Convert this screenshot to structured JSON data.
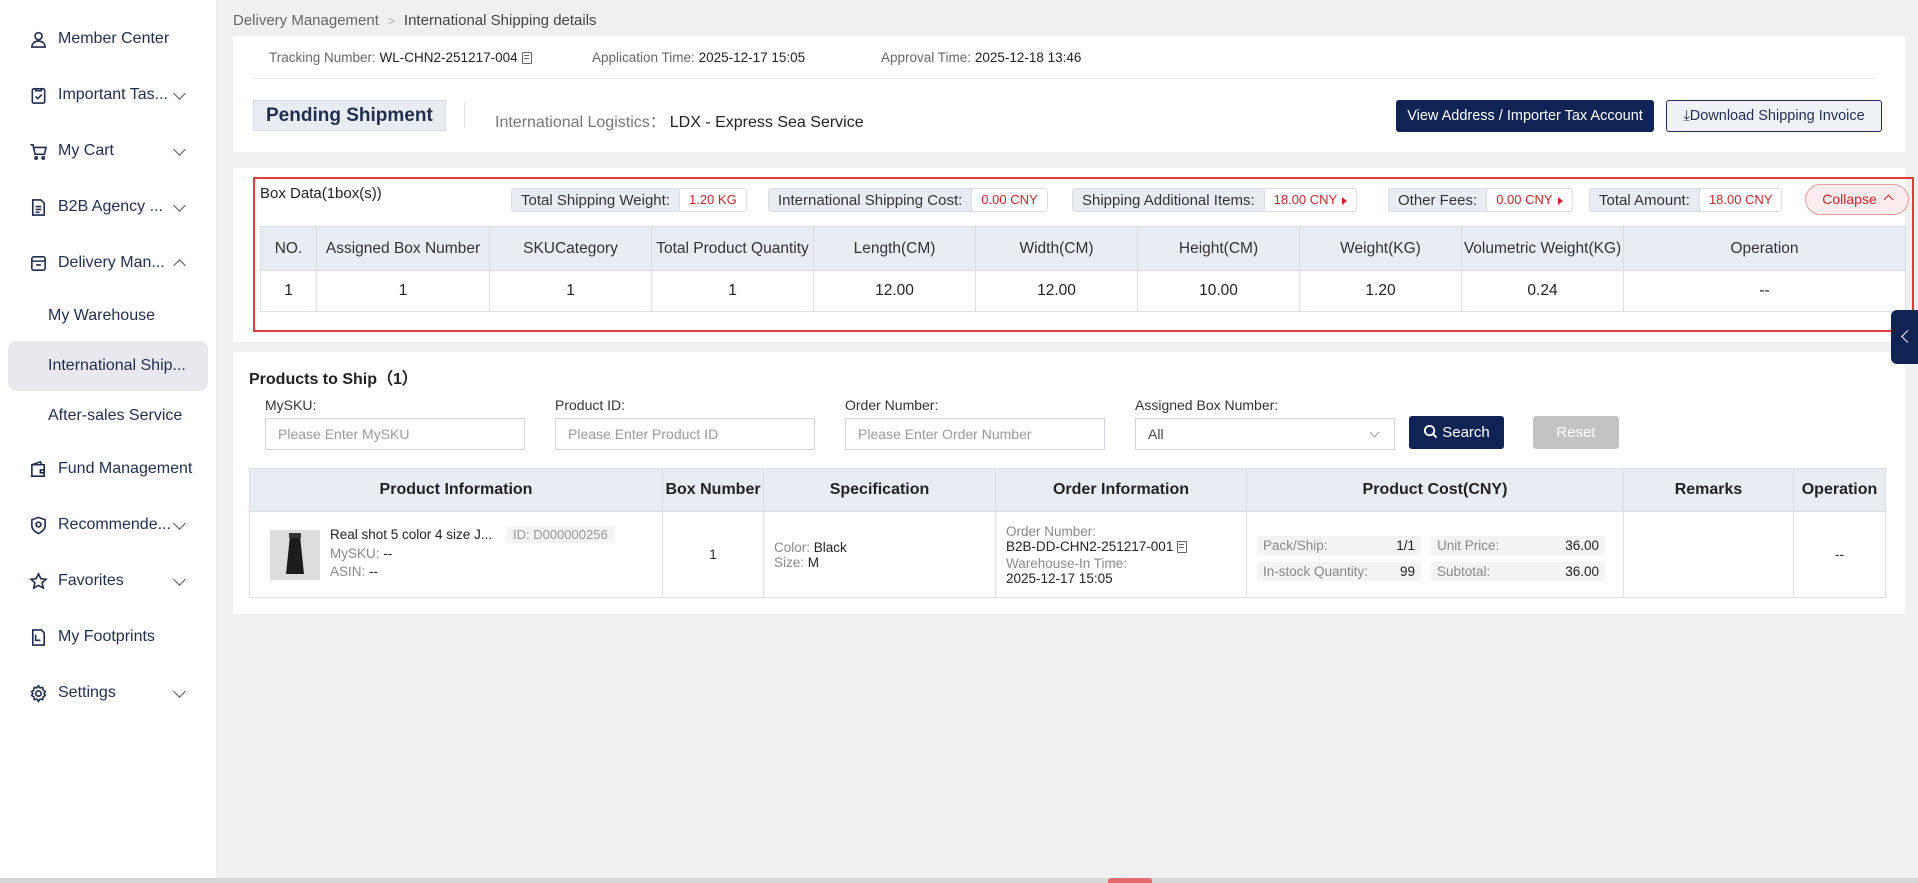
{
  "sidebar": {
    "items": [
      {
        "label": "Member Center",
        "icon": "user-icon"
      },
      {
        "label": "Important Tas...",
        "icon": "clipboard-check-icon"
      },
      {
        "label": "My Cart",
        "icon": "cart-icon"
      },
      {
        "label": "B2B Agency ...",
        "icon": "document-icon"
      },
      {
        "label": "Delivery Man...",
        "icon": "delivery-icon"
      },
      {
        "label": "My Warehouse"
      },
      {
        "label": "International Ship..."
      },
      {
        "label": "After-sales Service"
      },
      {
        "label": "Fund Management",
        "icon": "wallet-icon"
      },
      {
        "label": "Recommende...",
        "icon": "badge-icon"
      },
      {
        "label": "Favorites",
        "icon": "star-icon"
      },
      {
        "label": "My Footprints",
        "icon": "footprint-icon"
      },
      {
        "label": "Settings",
        "icon": "gear-icon"
      }
    ]
  },
  "breadcrumb": {
    "parent": "Delivery Management",
    "current": "International Shipping details"
  },
  "header": {
    "tracking_label": "Tracking Number:",
    "tracking_value": "WL-CHN2-251217-004",
    "application_label": "Application Time:",
    "application_value": "2025-12-17 15:05",
    "approval_label": "Approval Time:",
    "approval_value": "2025-12-18 13:46",
    "status": "Pending Shipment",
    "logistics_label": "International Logistics：",
    "logistics_value": "LDX - Express Sea Service",
    "btn_address": "View Address / Importer Tax Account",
    "btn_invoice": "Download Shipping Invoice"
  },
  "box_data": {
    "title": "Box Data(1box(s))",
    "total_weight_label": "Total Shipping Weight:",
    "total_weight_value": "1.20 KG",
    "intl_cost_label": "International Shipping Cost:",
    "intl_cost_value": "0.00 CNY",
    "additional_label": "Shipping Additional Items:",
    "additional_value": "18.00 CNY",
    "other_fees_label": "Other Fees:",
    "other_fees_value": "0.00 CNY",
    "total_amount_label": "Total Amount:",
    "total_amount_value": "18.00 CNY",
    "collapse_label": "Collapse",
    "columns": [
      "NO.",
      "Assigned Box Number",
      "SKUCategory",
      "Total Product Quantity",
      "Length(CM)",
      "Width(CM)",
      "Height(CM)",
      "Weight(KG)",
      "Volumetric Weight(KG)",
      "Operation"
    ],
    "rows": [
      [
        "1",
        "1",
        "1",
        "1",
        "12.00",
        "12.00",
        "10.00",
        "1.20",
        "0.24",
        "--"
      ]
    ]
  },
  "products": {
    "title": "Products to Ship（1）",
    "filters": {
      "mysku_label": "MySKU:",
      "mysku_placeholder": "Please Enter MySKU",
      "productid_label": "Product ID:",
      "productid_placeholder": "Please Enter Product ID",
      "order_label": "Order Number:",
      "order_placeholder": "Please Enter Order Number",
      "box_label": "Assigned Box Number:",
      "box_value": "All",
      "search": "Search",
      "reset": "Reset"
    },
    "columns": [
      "Product Information",
      "Box Number",
      "Specification",
      "Order Information",
      "Product Cost(CNY)",
      "Remarks",
      "Operation"
    ],
    "row": {
      "name": "Real shot 5 color 4 size J...",
      "id": "ID: D000000256",
      "mysku_label": "MySKU:",
      "mysku": "--",
      "asin_label": "ASIN:",
      "asin": "--",
      "box": "1",
      "color_label": "Color:",
      "color": "Black",
      "size_label": "Size:",
      "size": "M",
      "order_label": "Order Number:",
      "order": "B2B-DD-CHN2-251217-001",
      "warehouse_label": "Warehouse-In Time:",
      "warehouse": "2025-12-17 15:05",
      "pack_label": "Pack/Ship:",
      "pack": "1/1",
      "instock_label": "In-stock Quantity:",
      "instock": "99",
      "unit_label": "Unit Price:",
      "unit": "36.00",
      "subtotal_label": "Subtotal:",
      "subtotal": "36.00",
      "remarks": "",
      "operation": "--"
    }
  },
  "colors": {
    "primary": "#0f2355",
    "highlight_red": "#e0393e",
    "value_red": "#c62828"
  }
}
